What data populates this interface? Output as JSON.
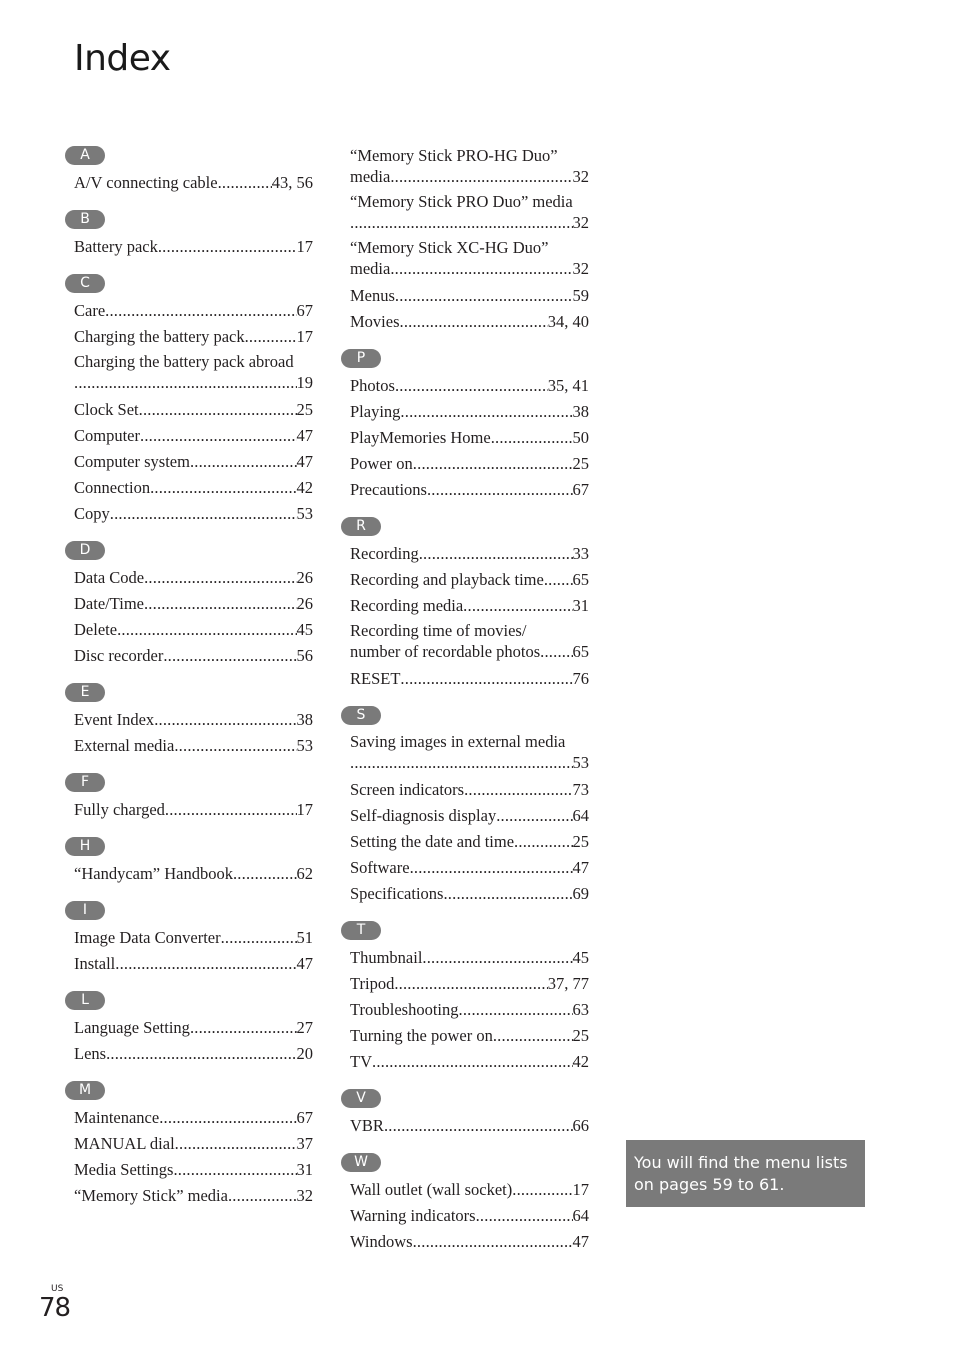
{
  "header": {
    "title": "Index"
  },
  "columns": [
    {
      "sections": [
        {
          "letter": "A",
          "entries": [
            {
              "term": "A/V connecting cable",
              "pages": "43, 56"
            }
          ]
        },
        {
          "letter": "B",
          "entries": [
            {
              "term": "Battery pack",
              "pages": "17"
            }
          ]
        },
        {
          "letter": "C",
          "entries": [
            {
              "term": "Care",
              "pages": "67"
            },
            {
              "term": "Charging the battery pack",
              "pages": "17"
            },
            {
              "term": "Charging the battery pack abroad",
              "pages": "19",
              "wrap": true
            },
            {
              "term": "Clock Set",
              "pages": "25"
            },
            {
              "term": "Computer",
              "pages": "47"
            },
            {
              "term": "Computer system",
              "pages": "47"
            },
            {
              "term": "Connection",
              "pages": "42"
            },
            {
              "term": "Copy",
              "pages": "53"
            }
          ]
        },
        {
          "letter": "D",
          "entries": [
            {
              "term": "Data Code",
              "pages": "26"
            },
            {
              "term": "Date/Time",
              "pages": "26"
            },
            {
              "term": "Delete",
              "pages": "45"
            },
            {
              "term": "Disc recorder",
              "pages": "56"
            }
          ]
        },
        {
          "letter": "E",
          "entries": [
            {
              "term": "Event Index",
              "pages": "38"
            },
            {
              "term": "External media",
              "pages": "53"
            }
          ]
        },
        {
          "letter": "F",
          "entries": [
            {
              "term": "Fully charged",
              "pages": "17"
            }
          ]
        },
        {
          "letter": "H",
          "entries": [
            {
              "term": "“Handycam” Handbook",
              "pages": "62"
            }
          ]
        },
        {
          "letter": "I",
          "entries": [
            {
              "term": "Image Data Converter",
              "pages": "51"
            },
            {
              "term": "Install",
              "pages": "47"
            }
          ]
        },
        {
          "letter": "L",
          "entries": [
            {
              "term": "Language Setting",
              "pages": "27"
            },
            {
              "term": "Lens",
              "pages": "20"
            }
          ]
        },
        {
          "letter": "M",
          "entries": [
            {
              "term": "Maintenance",
              "pages": "67"
            },
            {
              "term": "MANUAL dial",
              "pages": "37"
            },
            {
              "term": "Media Settings",
              "pages": "31"
            },
            {
              "term": "“Memory Stick” media",
              "pages": "32"
            }
          ]
        }
      ]
    },
    {
      "sections": [
        {
          "letter": "",
          "entries": [
            {
              "term": "“Memory Stick PRO-HG Duo”",
              "term2": "media",
              "pages": "32",
              "wrap2": true
            },
            {
              "term": "“Memory Stick PRO Duo” media",
              "pages": "32",
              "wrap": true
            },
            {
              "term": "“Memory Stick XC-HG Duo”",
              "term2": "media",
              "pages": "32",
              "wrap2": true
            },
            {
              "term": "Menus",
              "pages": "59"
            },
            {
              "term": "Movies",
              "pages": "34, 40"
            }
          ]
        },
        {
          "letter": "P",
          "entries": [
            {
              "term": "Photos",
              "pages": "35, 41"
            },
            {
              "term": "Playing",
              "pages": "38"
            },
            {
              "term": "PlayMemories Home",
              "pages": "50"
            },
            {
              "term": "Power on",
              "pages": "25"
            },
            {
              "term": "Precautions",
              "pages": "67"
            }
          ]
        },
        {
          "letter": "R",
          "entries": [
            {
              "term": "Recording",
              "pages": "33"
            },
            {
              "term": "Recording and playback time",
              "pages": "65"
            },
            {
              "term": "Recording media",
              "pages": "31"
            },
            {
              "term": "Recording time of movies/",
              "term2": "number of recordable photos",
              "pages": "65",
              "wrap2": true
            },
            {
              "term": "RESET",
              "pages": "76"
            }
          ]
        },
        {
          "letter": "S",
          "entries": [
            {
              "term": "Saving images in external media",
              "pages": "53",
              "wrap": true
            },
            {
              "term": "Screen indicators",
              "pages": "73"
            },
            {
              "term": "Self-diagnosis display",
              "pages": "64"
            },
            {
              "term": "Setting the date and time",
              "pages": "25"
            },
            {
              "term": "Software",
              "pages": "47"
            },
            {
              "term": "Specifications",
              "pages": "69"
            }
          ]
        },
        {
          "letter": "T",
          "entries": [
            {
              "term": "Thumbnail",
              "pages": "45"
            },
            {
              "term": "Tripod",
              "pages": "37, 77"
            },
            {
              "term": "Troubleshooting",
              "pages": "63"
            },
            {
              "term": "Turning the power on",
              "pages": "25"
            },
            {
              "term": "TV",
              "pages": "42"
            }
          ]
        },
        {
          "letter": "V",
          "entries": [
            {
              "term": "VBR",
              "pages": "66"
            }
          ]
        },
        {
          "letter": "W",
          "entries": [
            {
              "term": "Wall outlet (wall socket)",
              "pages": "17"
            },
            {
              "term": "Warning indicators",
              "pages": "64"
            },
            {
              "term": "Windows",
              "pages": "47"
            }
          ]
        }
      ]
    }
  ],
  "note": {
    "text": "You will find the menu lists on pages 59 to 61."
  },
  "footer": {
    "region": "US",
    "page_number": "78"
  },
  "colors": {
    "badge": "#7a7a7a",
    "note_bg": "#7a7a7a",
    "text": "#231f20"
  }
}
